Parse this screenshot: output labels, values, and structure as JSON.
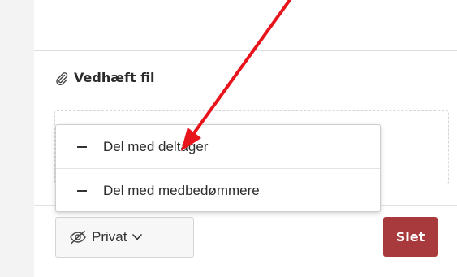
{
  "attachments": {
    "heading": "Vedhæft fil",
    "icon": "paperclip-icon"
  },
  "share_menu": {
    "items": [
      {
        "label": "Del med deltager",
        "icon": "dash-icon"
      },
      {
        "label": "Del med medbedømmere",
        "icon": "dash-icon"
      }
    ]
  },
  "toolbar": {
    "privacy_label": "Privat",
    "privacy_icon": "eye-slash-icon",
    "dropdown_icon": "chevron-down-icon",
    "delete_label": "Slet"
  },
  "colors": {
    "delete_background": "#a83a3d",
    "annotation_arrow": "#e8141b"
  }
}
